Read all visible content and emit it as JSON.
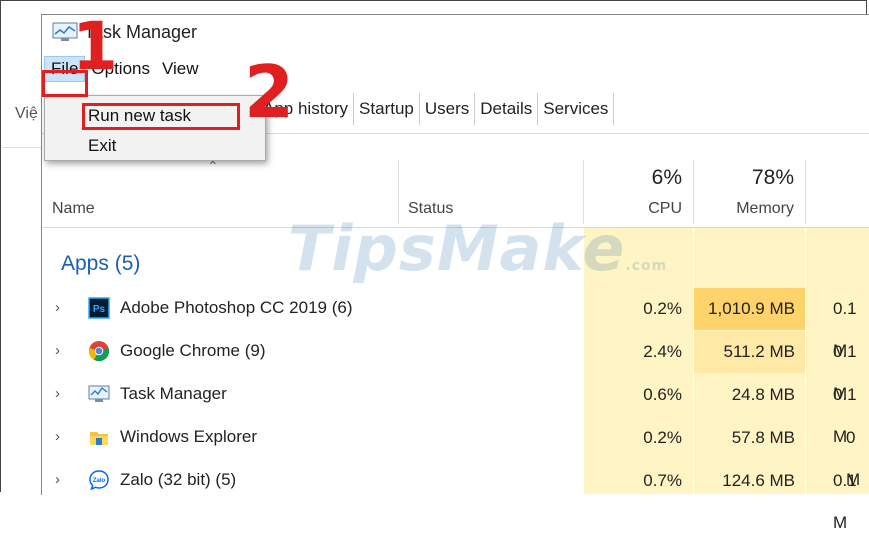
{
  "title": "Task Manager",
  "bg_fragment_text": "Việ",
  "menu": [
    "File",
    "Options",
    "View"
  ],
  "file_menu": [
    "Run new task",
    "Exit"
  ],
  "tabs": [
    "App history",
    "Startup",
    "Users",
    "Details",
    "Services"
  ],
  "columns": {
    "name": "Name",
    "status": "Status",
    "cpu": {
      "pct": "6%",
      "label": "CPU"
    },
    "memory": {
      "pct": "78%",
      "label": "Memory"
    }
  },
  "group": "Apps (5)",
  "rows": [
    {
      "name": "Adobe Photoshop CC 2019 (6)",
      "icon": "photoshop-icon",
      "cpu": "0.2%",
      "memory": "1,010.9 MB",
      "disk": "0.1 M"
    },
    {
      "name": "Google Chrome (9)",
      "icon": "chrome-icon",
      "cpu": "2.4%",
      "memory": "511.2 MB",
      "disk": "0.1 M"
    },
    {
      "name": "Task Manager",
      "icon": "task-manager-icon",
      "cpu": "0.6%",
      "memory": "24.8 MB",
      "disk": "0.1 M"
    },
    {
      "name": "Windows Explorer",
      "icon": "folder-icon",
      "cpu": "0.2%",
      "memory": "57.8 MB",
      "disk": "0 M"
    },
    {
      "name": "Zalo (32 bit) (5)",
      "icon": "zalo-icon",
      "cpu": "0.7%",
      "memory": "124.6 MB",
      "disk": "0.1 M"
    }
  ],
  "annotations": {
    "step1": "1",
    "step2": "2"
  },
  "watermark": {
    "main": "TipsMake",
    "suffix": ".com"
  },
  "colors": {
    "accent_red": "#e02020",
    "cpu_heat": "#fff0b5",
    "mem_heat_high": "#ffd36b",
    "mem_heat_mid": "#ffe9a6",
    "mem_heat_low": "#fff4c4",
    "group_blue": "#1a5fb4"
  }
}
